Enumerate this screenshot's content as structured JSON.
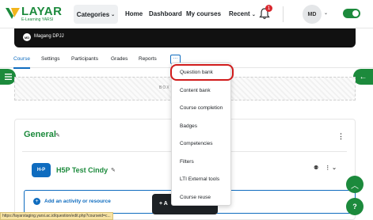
{
  "brand": {
    "title": "LAYAR",
    "subtitle": "E-Learning YARSI",
    "color": "#1c8a3c"
  },
  "nav": {
    "categories": "Categories",
    "home": "Home",
    "dashboard": "Dashboard",
    "my_courses": "My courses",
    "recent": "Recent",
    "notification_count": "1",
    "user_initials": "MD"
  },
  "banner": {
    "avatar": "MD",
    "name": "Magang DPJJ"
  },
  "tabs": [
    "Course",
    "Settings",
    "Participants",
    "Grades",
    "Reports"
  ],
  "more_label": "...",
  "hatch_text": "BOX",
  "dropdown": {
    "items": [
      "Question bank",
      "Content bank",
      "Course completion",
      "Badges",
      "Competencies",
      "Filters",
      "LTI External tools",
      "Course reuse"
    ],
    "highlighted": "Question bank"
  },
  "section": {
    "title": "General",
    "activity": {
      "icon_text": "H-P",
      "name": "H5P Test Cindy"
    },
    "add_activity": "Add an activity or resource"
  },
  "dark_button": "+ A",
  "status_url": "https://layarstaging.yarsi.ac.id/question/edit.php?courseid=c...",
  "icons": {
    "left_drawer": "menu-icon",
    "right_drawer": "arrow-left-icon",
    "scroll_top": "chevron-up-icon",
    "help": "question-icon"
  }
}
